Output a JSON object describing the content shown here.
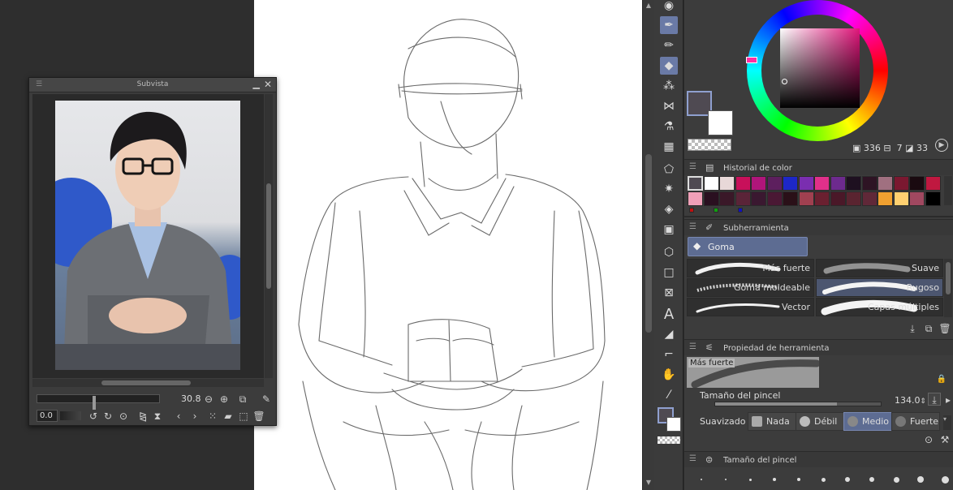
{
  "subvista": {
    "title": "Subvista",
    "zoom": "30.8",
    "rotation": "0.0"
  },
  "panels": {
    "color_history": {
      "title": "Historial de color"
    },
    "subtool": {
      "title": "Subherramienta",
      "group": "Goma",
      "brushes": [
        "Más fuerte",
        "Suave",
        "Goma moldeable",
        "Rugoso",
        "Vector",
        "Capas múltiples"
      ],
      "selected": "Rugoso"
    },
    "tool_property": {
      "title": "Propiedad de herramienta",
      "preview_label": "Más fuerte",
      "brush_size_label": "Tamaño del pincel",
      "brush_size_value": "134.0",
      "smoothing_label": "Suavizado",
      "smoothing_options": [
        "Nada",
        "Débil",
        "Medio",
        "Fuerte"
      ],
      "smoothing_selected": "Medio"
    },
    "brush_size": {
      "title": "Tamaño del pincel"
    }
  },
  "color": {
    "main": "#4f4a52",
    "sub": "#ffffff",
    "value_a": "336",
    "value_b": "7",
    "value_c": "33"
  },
  "history_colors": [
    "#4f4a52",
    "#ffffff",
    "#e8d8d8",
    "#c8105a",
    "#b0157a",
    "#5d1f5e",
    "#1d27c8",
    "#7a2eb0",
    "#e0308a",
    "#6d2a8e",
    "#1e1020",
    "#2e1424",
    "#a07080",
    "#7a1830",
    "#1a0a10",
    "#c01840",
    "#f0a0b8",
    "#2a1020",
    "#3a1828",
    "#5a2438",
    "#3a1830",
    "#4a1834",
    "#2a1018",
    "#a04050",
    "#6a2030",
    "#4a1828",
    "#5a2430",
    "#602838",
    "#f0a030",
    "#ffd070",
    "#a04860",
    "#000000"
  ],
  "history_extra": [
    "#c01010",
    "#10a010",
    "#1010c0"
  ],
  "tools": [
    "cursor-icon",
    "pen-icon",
    "pencil-icon",
    "eraser-icon",
    "airbrush-icon",
    "decoration-icon",
    "blend-icon",
    "grid-icon",
    "lasso-icon",
    "magic-wand-icon",
    "fill-icon",
    "gradient-icon",
    "object-icon",
    "rectangle-icon",
    "frame-icon",
    "text-icon",
    "balloon-icon",
    "ruler-icon",
    "hand-icon",
    "eyedropper-icon"
  ]
}
